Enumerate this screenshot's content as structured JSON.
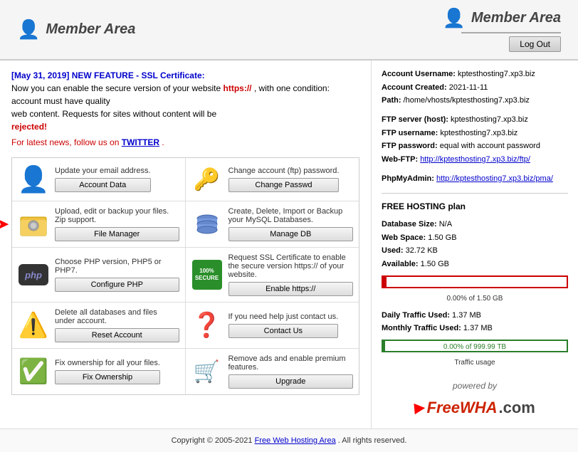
{
  "header": {
    "left_icon": "👤",
    "title": "Member Area",
    "right_icon": "👤",
    "right_title": "Member Area",
    "logout_label": "Log Out"
  },
  "announcement": {
    "date_feature": "[May 31, 2019] NEW FEATURE - SSL Certificate:",
    "line1": "Now you can enable the secure version of your website",
    "https_text": "https://",
    "line1b": ", with one condition: account must have quality",
    "line2": "web content. Requests for sites without content will be",
    "rejected": "rejected!",
    "news_prefix": "For latest news, follow us on",
    "twitter": "TWITTER",
    "news_suffix": "."
  },
  "grid": [
    {
      "icon": "person",
      "text": "Update your email address.",
      "button": "Account Data"
    },
    {
      "icon": "key",
      "text": "Change account (ftp) password.",
      "button": "Change Passwd"
    },
    {
      "icon": "folder",
      "text": "Upload, edit or backup your files. Zip support.",
      "button": "File Manager",
      "has_arrow": true
    },
    {
      "icon": "db",
      "text": "Create, Delete, Import or Backup your MySQL Databases.",
      "button": "Manage DB"
    },
    {
      "icon": "php",
      "text": "Choose PHP version, PHP5 or PHP7.",
      "button": "Configure PHP"
    },
    {
      "icon": "secure",
      "text": "Request SSL Certificate to enable the secure version https:// of your website.",
      "button": "Enable https://"
    },
    {
      "icon": "warning",
      "text": "Delete all databases and files under account.",
      "button": "Reset Account"
    },
    {
      "icon": "question",
      "text": "If you need help just contact us.",
      "button": "Contact Us"
    },
    {
      "icon": "check",
      "text": "Fix ownership for all your files.",
      "button": "Fix Ownership"
    },
    {
      "icon": "cart",
      "text": "Remove ads and enable premium features.",
      "button": "Upgrade"
    }
  ],
  "account": {
    "username_label": "Account Username:",
    "username_val": "kptesthosting7.xp3.biz",
    "created_label": "Account Created:",
    "created_val": "2021-11-11",
    "path_label": "Path:",
    "path_val": "/home/vhosts/kptesthosting7.xp3.biz",
    "ftp_server_label": "FTP server (host):",
    "ftp_server_val": "kptesthosting7.xp3.biz",
    "ftp_username_label": "FTP username:",
    "ftp_username_val": "kptesthosting7.xp3.biz",
    "ftp_password_label": "FTP password:",
    "ftp_password_val": "equal with account password",
    "webftp_label": "Web-FTP:",
    "webftp_link": "http://kptesthosting7.xp3.biz/ftp/",
    "phpmyadmin_label": "PhpMyAdmin:",
    "phpmyadmin_link": "http://kptesthosting7.xp3.biz/pma/"
  },
  "hosting": {
    "plan_title": "FREE HOSTING plan",
    "db_label": "Database Size:",
    "db_val": "N/A",
    "webspace_label": "Web Space:",
    "webspace_val": "1.50 GB",
    "used_label": "Used:",
    "used_val": "32.72 KB",
    "available_label": "Available:",
    "available_val": "1.50 GB",
    "progress_text": "0.00% of 1.50 GB",
    "daily_traffic_label": "Daily Traffic Used:",
    "daily_traffic_val": "1.37 MB",
    "monthly_traffic_label": "Monthly Traffic Used:",
    "monthly_traffic_val": "1.37 MB",
    "traffic_progress_text": "0.00% of 999.99 TB",
    "traffic_usage_label": "Traffic usage"
  },
  "powered": {
    "text": "powered by",
    "brand": "FreeWHA",
    "com": ".com"
  },
  "footer": {
    "copyright": "Copyright © 2005-2021",
    "link_text": "Free Web Hosting Area",
    "suffix": ". All rights reserved."
  }
}
